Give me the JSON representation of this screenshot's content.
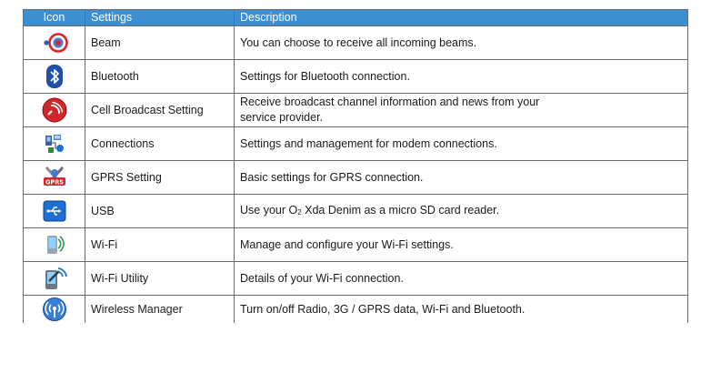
{
  "header": {
    "icon": "Icon",
    "settings": "Settings",
    "description": "Description"
  },
  "rows": [
    {
      "icon": "beam-icon",
      "setting": "Beam",
      "description": "You can choose to receive all incoming beams."
    },
    {
      "icon": "bluetooth-icon",
      "setting": "Bluetooth",
      "description": "Settings for Bluetooth connection."
    },
    {
      "icon": "cell-broadcast-icon",
      "setting": "Cell Broadcast Setting",
      "description_line1": "Receive broadcast channel information and news from your",
      "description_line2": "service provider."
    },
    {
      "icon": "connections-icon",
      "setting": "Connections",
      "description": "Settings and management for modem connections."
    },
    {
      "icon": "gprs-icon",
      "setting": "GPRS Setting",
      "description": "Basic settings for GPRS connection.",
      "icon_text": "GPRS"
    },
    {
      "icon": "usb-icon",
      "setting": "USB",
      "description_pre": "Use your O",
      "description_sub": "2",
      "description_post": " Xda Denim as a micro SD card reader."
    },
    {
      "icon": "wifi-icon",
      "setting": "Wi-Fi",
      "description": "Manage and configure your Wi-Fi settings."
    },
    {
      "icon": "wifi-utility-icon",
      "setting": "Wi-Fi Utility",
      "description": "Details of your Wi-Fi connection."
    },
    {
      "icon": "wireless-manager-icon",
      "setting": "Wireless Manager",
      "description": "Turn on/off Radio, 3G / GPRS data, Wi-Fi and Bluetooth."
    }
  ],
  "colors": {
    "header_bg": "#3d8fd3",
    "border": "#6a6a6a"
  }
}
